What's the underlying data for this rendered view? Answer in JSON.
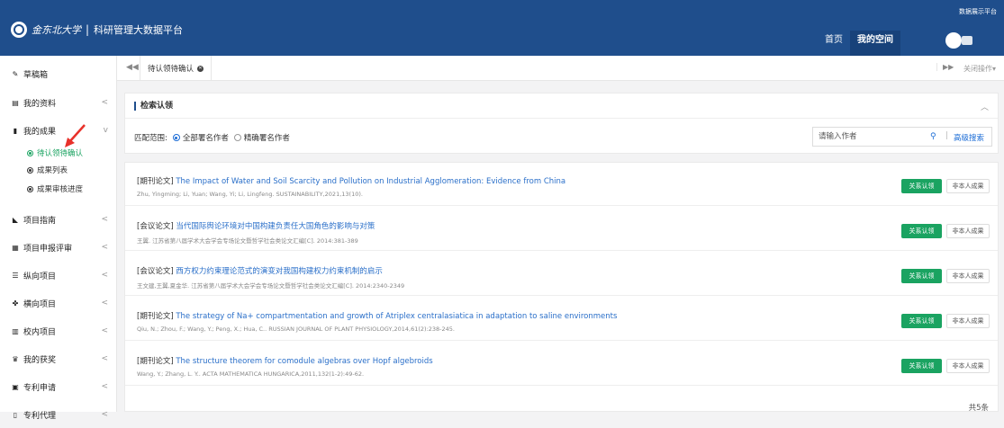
{
  "header": {
    "logo_text": "金东北大学",
    "title": "科研管理大数据平台",
    "top_right_link": "数据展示平台",
    "nav": [
      {
        "label": "首页",
        "active": false
      },
      {
        "label": "我的空间",
        "active": true
      }
    ]
  },
  "sidebar": {
    "items": [
      {
        "label": "草稿箱",
        "icon": "draft-icon",
        "chevron": ""
      },
      {
        "label": "我的资料",
        "icon": "card-icon",
        "chevron": "<"
      },
      {
        "label": "我的成果",
        "icon": "doc-icon",
        "chevron": "v"
      },
      {
        "label": "项目指南",
        "icon": "rss-icon",
        "chevron": "<"
      },
      {
        "label": "项目申报评审",
        "icon": "calendar-icon",
        "chevron": "<"
      },
      {
        "label": "纵向项目",
        "icon": "list-icon",
        "chevron": "<"
      },
      {
        "label": "横向项目",
        "icon": "share-icon",
        "chevron": "<"
      },
      {
        "label": "校内项目",
        "icon": "bank-icon",
        "chevron": "<"
      },
      {
        "label": "我的获奖",
        "icon": "trophy-icon",
        "chevron": "<"
      },
      {
        "label": "专利申请",
        "icon": "image-icon",
        "chevron": "<"
      },
      {
        "label": "专利代理",
        "icon": "file-icon",
        "chevron": "<"
      }
    ],
    "sub_items": [
      {
        "label": "待认领待确认",
        "active": true
      },
      {
        "label": "成果列表",
        "active": false
      },
      {
        "label": "成果审核进度",
        "active": false
      }
    ]
  },
  "tabs": {
    "active_tab": "待认领待确认",
    "close_ops": "关闭操作"
  },
  "search": {
    "panel_title": "检索认领",
    "scope_label": "匹配范围:",
    "scope_options": [
      {
        "label": "全部署名作者",
        "checked": true
      },
      {
        "label": "精确署名作者",
        "checked": false
      }
    ],
    "author_placeholder": "请输入作者",
    "advanced_label": "高级搜索"
  },
  "results": {
    "claim_label": "关系认领",
    "not_mine_label": "非本人成果",
    "rows": [
      {
        "type": "[期刊论文]",
        "title": "The Impact of Water and Soil Scarcity and Pollution on Industrial Agglomeration: Evidence from China",
        "meta": "Zhu, Yingming; Li, Yuan; Wang, Yi; Li, Lingfeng. SUSTAINABILITY,2021,13(10)."
      },
      {
        "type": "[会议论文]",
        "title": "当代国际舆论环境对中国构建负责任大国角色的影响与对策",
        "meta": "王翼. 江苏省第八届学术大会学会专场论文暨哲学社会类论文汇编[C]. 2014:381-389"
      },
      {
        "type": "[会议论文]",
        "title": "西方权力约束理论范式的演变对我国构建权力约束机制的启示",
        "meta": "王文建,王翼,夏金华. 江苏省第八届学术大会学会专场论文暨哲学社会类论文汇编[C]. 2014:2340-2349"
      },
      {
        "type": "[期刊论文]",
        "title": "The strategy of Na+ compartmentation and growth of Atriplex centralasiatica in adaptation to saline environments",
        "meta": "Qiu, N.; Zhou, F.; Wang, Y.; Peng, X.; Hua, C.. RUSSIAN JOURNAL OF PLANT PHYSIOLOGY,2014,61(2):238-245."
      },
      {
        "type": "[期刊论文]",
        "title": "The structure theorem for comodule algebras over Hopf algebroids",
        "meta": "Wang, Y.; Zhang, L. Y.. ACTA MATHEMATICA HUNGARICA,2011,132(1-2):49-62."
      }
    ],
    "total": "共5条"
  },
  "colors": {
    "header_bg": "#1f4e8c",
    "accent_green": "#1aa361",
    "link_blue": "#2a6fc9",
    "arrow_red": "#e8312a"
  }
}
